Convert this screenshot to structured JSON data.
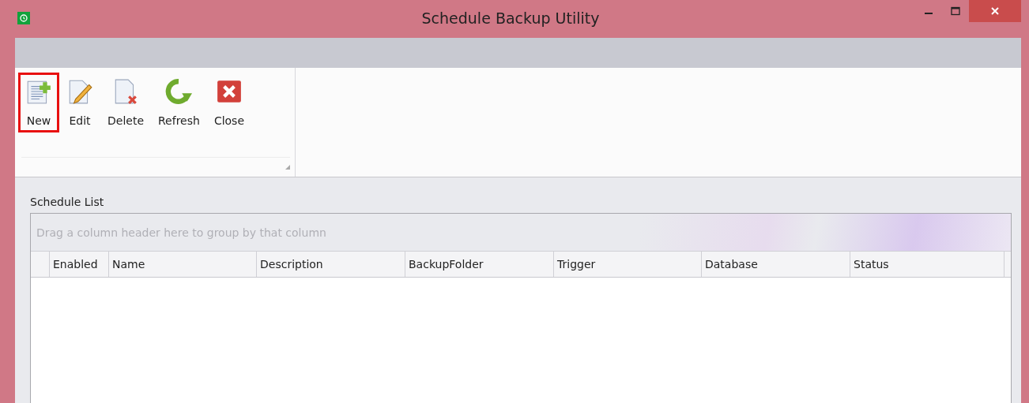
{
  "window": {
    "title": "Schedule Backup Utility"
  },
  "toolbar": {
    "buttons": [
      {
        "kind": "new",
        "label": "New",
        "highlighted": true
      },
      {
        "kind": "edit",
        "label": "Edit",
        "highlighted": false
      },
      {
        "kind": "delete",
        "label": "Delete",
        "highlighted": false
      },
      {
        "kind": "refresh",
        "label": "Refresh",
        "highlighted": false
      },
      {
        "kind": "close",
        "label": "Close",
        "highlighted": false
      }
    ]
  },
  "schedule_list": {
    "title": "Schedule List",
    "group_panel_hint": "Drag a column header here to group by that column",
    "columns": [
      "Enabled",
      "Name",
      "Description",
      "BackupFolder",
      "Trigger",
      "Database",
      "Status"
    ]
  }
}
